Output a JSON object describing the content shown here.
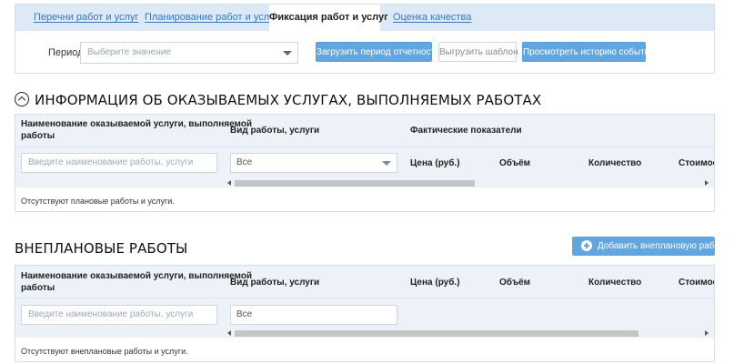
{
  "tabs": [
    {
      "label": "Перечни работ и услуг",
      "active": false
    },
    {
      "label": "Планирование работ и услуг",
      "active": false
    },
    {
      "label": "Фиксация работ и услуг",
      "active": true
    },
    {
      "label": "Оценка качества",
      "active": false
    }
  ],
  "period": {
    "label": "Период",
    "placeholder": "Выберите значение"
  },
  "toolbar": {
    "load_period": "Загрузить период отчетности",
    "export_template": "Выгрузить шаблон",
    "view_history": "Просмотреть историю событий"
  },
  "planned": {
    "title": "ИНФОРМАЦИЯ ОБ ОКАЗЫВАЕМЫХ УСЛУГАХ, ВЫПОЛНЯЕМЫХ РАБОТАХ",
    "columns": {
      "service_name_line1": "Наименование оказываемой услуги, выполняемой",
      "service_name_line2": "работы",
      "work_type": "Вид работы, услуги",
      "actual_indicators": "Фактические показатели",
      "price": "Цена (руб.)",
      "volume": "Объём",
      "quantity": "Количество",
      "cost": "Стоимость"
    },
    "name_filter_placeholder": "Введите наименование работы, услуги",
    "type_filter_value": "Все",
    "empty_message": "Отсутствуют плановые работы и услуги."
  },
  "unplanned": {
    "title": "ВНЕПЛАНОВЫЕ РАБОТЫ",
    "add_button": "Добавить внеплановую работу",
    "columns": {
      "service_name_line1": "Наименование оказываемой услуги, выполняемой",
      "service_name_line2": "работы",
      "work_type": "Вид работы, услуги",
      "price": "Цена (руб.)",
      "volume": "Объём",
      "quantity": "Количество",
      "cost": "Стоимость"
    },
    "name_filter_placeholder": "Введите наименование работы, услуги",
    "type_filter_value": "Все",
    "empty_message": "Отсутствуют внеплановые работы и услуги."
  },
  "colors": {
    "accent": "#62a6e0",
    "tab_bar": "#dde9f5",
    "link": "#3478c0",
    "header_bg": "#ecf2f8"
  }
}
